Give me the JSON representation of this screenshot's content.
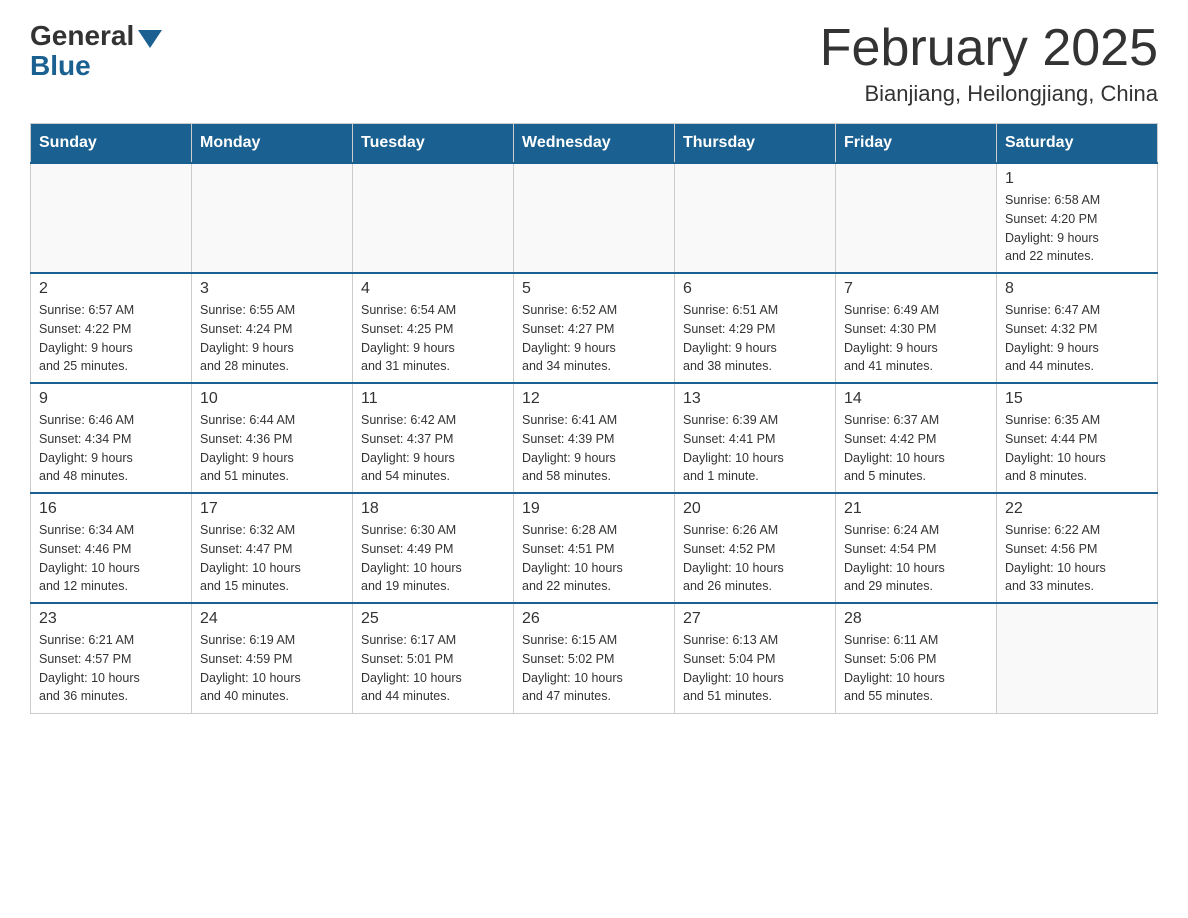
{
  "logo": {
    "general": "General",
    "blue": "Blue"
  },
  "title": "February 2025",
  "location": "Bianjiang, Heilongjiang, China",
  "days_header": [
    "Sunday",
    "Monday",
    "Tuesday",
    "Wednesday",
    "Thursday",
    "Friday",
    "Saturday"
  ],
  "weeks": [
    [
      {
        "day": "",
        "info": ""
      },
      {
        "day": "",
        "info": ""
      },
      {
        "day": "",
        "info": ""
      },
      {
        "day": "",
        "info": ""
      },
      {
        "day": "",
        "info": ""
      },
      {
        "day": "",
        "info": ""
      },
      {
        "day": "1",
        "info": "Sunrise: 6:58 AM\nSunset: 4:20 PM\nDaylight: 9 hours\nand 22 minutes."
      }
    ],
    [
      {
        "day": "2",
        "info": "Sunrise: 6:57 AM\nSunset: 4:22 PM\nDaylight: 9 hours\nand 25 minutes."
      },
      {
        "day": "3",
        "info": "Sunrise: 6:55 AM\nSunset: 4:24 PM\nDaylight: 9 hours\nand 28 minutes."
      },
      {
        "day": "4",
        "info": "Sunrise: 6:54 AM\nSunset: 4:25 PM\nDaylight: 9 hours\nand 31 minutes."
      },
      {
        "day": "5",
        "info": "Sunrise: 6:52 AM\nSunset: 4:27 PM\nDaylight: 9 hours\nand 34 minutes."
      },
      {
        "day": "6",
        "info": "Sunrise: 6:51 AM\nSunset: 4:29 PM\nDaylight: 9 hours\nand 38 minutes."
      },
      {
        "day": "7",
        "info": "Sunrise: 6:49 AM\nSunset: 4:30 PM\nDaylight: 9 hours\nand 41 minutes."
      },
      {
        "day": "8",
        "info": "Sunrise: 6:47 AM\nSunset: 4:32 PM\nDaylight: 9 hours\nand 44 minutes."
      }
    ],
    [
      {
        "day": "9",
        "info": "Sunrise: 6:46 AM\nSunset: 4:34 PM\nDaylight: 9 hours\nand 48 minutes."
      },
      {
        "day": "10",
        "info": "Sunrise: 6:44 AM\nSunset: 4:36 PM\nDaylight: 9 hours\nand 51 minutes."
      },
      {
        "day": "11",
        "info": "Sunrise: 6:42 AM\nSunset: 4:37 PM\nDaylight: 9 hours\nand 54 minutes."
      },
      {
        "day": "12",
        "info": "Sunrise: 6:41 AM\nSunset: 4:39 PM\nDaylight: 9 hours\nand 58 minutes."
      },
      {
        "day": "13",
        "info": "Sunrise: 6:39 AM\nSunset: 4:41 PM\nDaylight: 10 hours\nand 1 minute."
      },
      {
        "day": "14",
        "info": "Sunrise: 6:37 AM\nSunset: 4:42 PM\nDaylight: 10 hours\nand 5 minutes."
      },
      {
        "day": "15",
        "info": "Sunrise: 6:35 AM\nSunset: 4:44 PM\nDaylight: 10 hours\nand 8 minutes."
      }
    ],
    [
      {
        "day": "16",
        "info": "Sunrise: 6:34 AM\nSunset: 4:46 PM\nDaylight: 10 hours\nand 12 minutes."
      },
      {
        "day": "17",
        "info": "Sunrise: 6:32 AM\nSunset: 4:47 PM\nDaylight: 10 hours\nand 15 minutes."
      },
      {
        "day": "18",
        "info": "Sunrise: 6:30 AM\nSunset: 4:49 PM\nDaylight: 10 hours\nand 19 minutes."
      },
      {
        "day": "19",
        "info": "Sunrise: 6:28 AM\nSunset: 4:51 PM\nDaylight: 10 hours\nand 22 minutes."
      },
      {
        "day": "20",
        "info": "Sunrise: 6:26 AM\nSunset: 4:52 PM\nDaylight: 10 hours\nand 26 minutes."
      },
      {
        "day": "21",
        "info": "Sunrise: 6:24 AM\nSunset: 4:54 PM\nDaylight: 10 hours\nand 29 minutes."
      },
      {
        "day": "22",
        "info": "Sunrise: 6:22 AM\nSunset: 4:56 PM\nDaylight: 10 hours\nand 33 minutes."
      }
    ],
    [
      {
        "day": "23",
        "info": "Sunrise: 6:21 AM\nSunset: 4:57 PM\nDaylight: 10 hours\nand 36 minutes."
      },
      {
        "day": "24",
        "info": "Sunrise: 6:19 AM\nSunset: 4:59 PM\nDaylight: 10 hours\nand 40 minutes."
      },
      {
        "day": "25",
        "info": "Sunrise: 6:17 AM\nSunset: 5:01 PM\nDaylight: 10 hours\nand 44 minutes."
      },
      {
        "day": "26",
        "info": "Sunrise: 6:15 AM\nSunset: 5:02 PM\nDaylight: 10 hours\nand 47 minutes."
      },
      {
        "day": "27",
        "info": "Sunrise: 6:13 AM\nSunset: 5:04 PM\nDaylight: 10 hours\nand 51 minutes."
      },
      {
        "day": "28",
        "info": "Sunrise: 6:11 AM\nSunset: 5:06 PM\nDaylight: 10 hours\nand 55 minutes."
      },
      {
        "day": "",
        "info": ""
      }
    ]
  ]
}
